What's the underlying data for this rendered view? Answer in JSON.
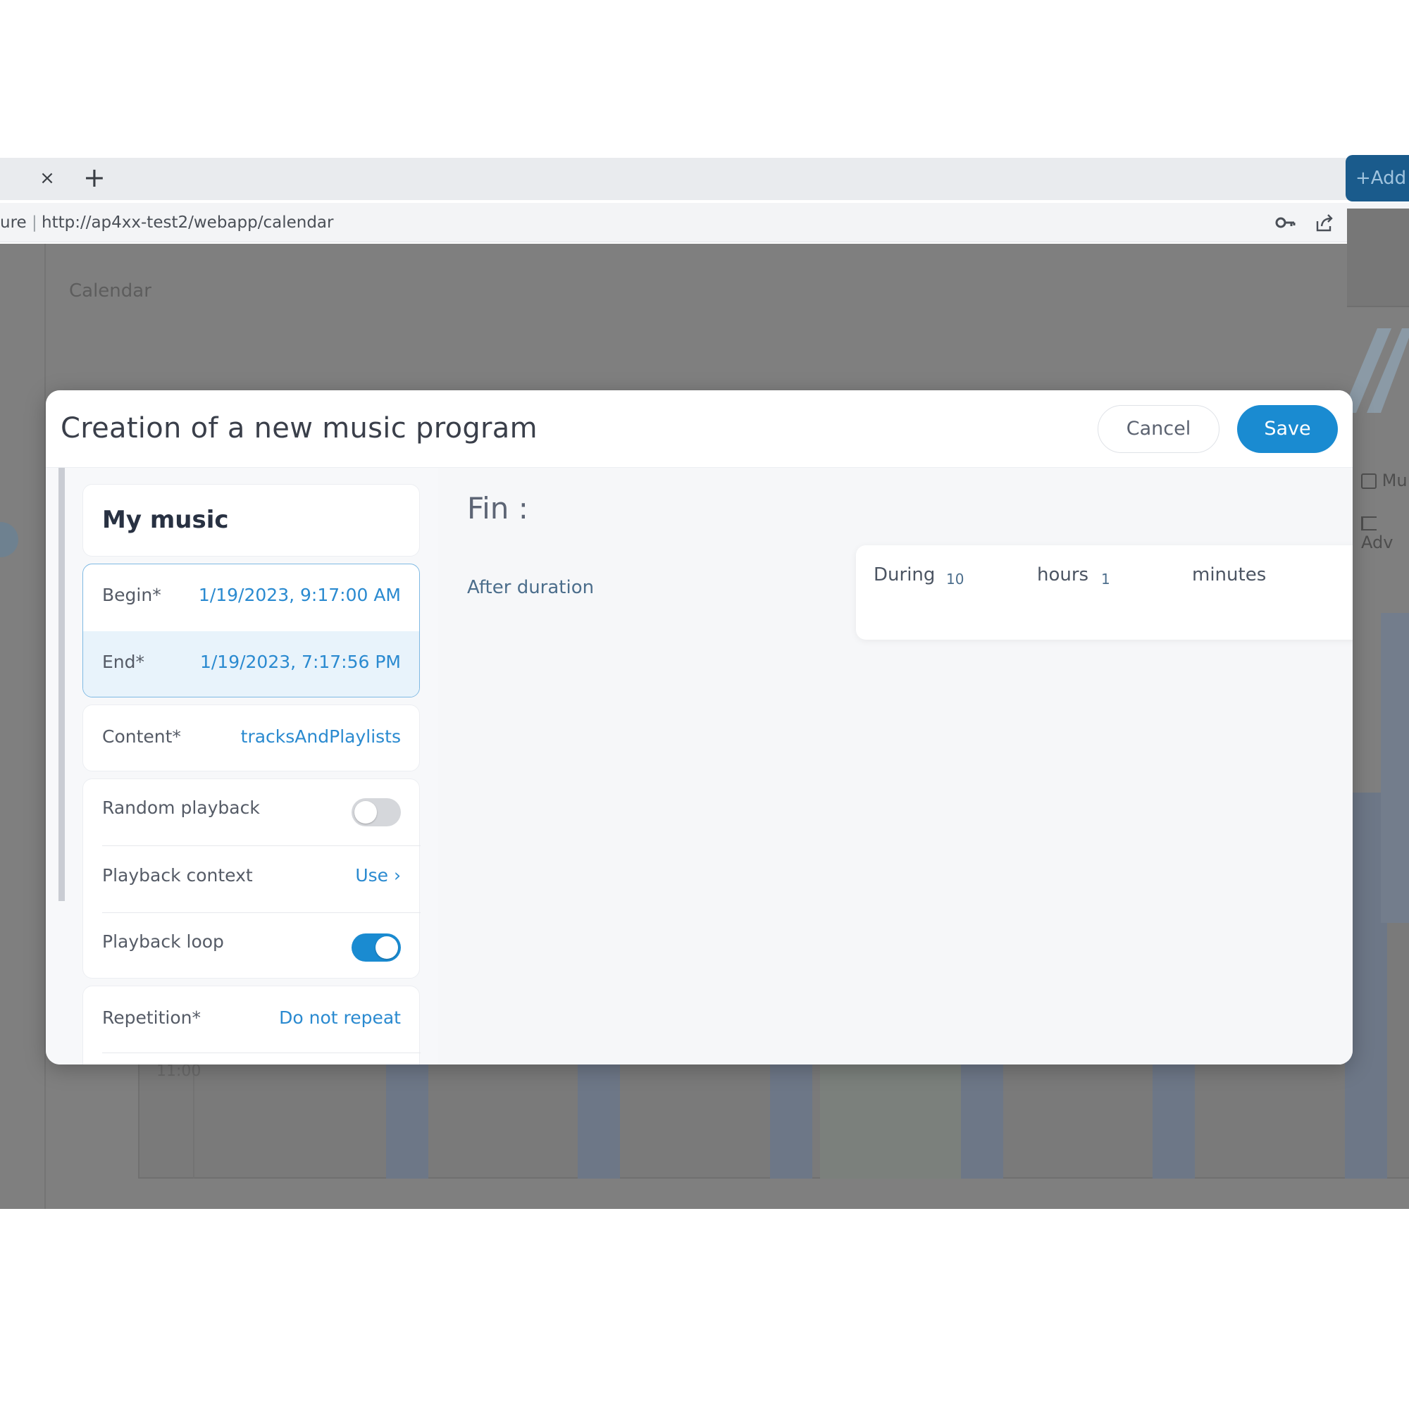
{
  "browser": {
    "tab_close": "×",
    "new_tab": "+",
    "url_prefix": "ure",
    "url": "http://ap4xx-test2/webapp/calendar",
    "icons": [
      "key-icon",
      "share-icon",
      "star-icon"
    ]
  },
  "app": {
    "title": "Calendar",
    "add_label": "+Add",
    "side_items": [
      {
        "icon": "music-note-icon",
        "label": "Mu"
      },
      {
        "icon": "megaphone-icon",
        "label": "Adv"
      }
    ],
    "time_label": "11:00"
  },
  "modal": {
    "title": "Creation of a new music program",
    "cancel_label": "Cancel",
    "save_label": "Save",
    "form": {
      "name": "My music",
      "begin_label": "Begin*",
      "begin_value": "1/19/2023, 9:17:00 AM",
      "end_label": "End*",
      "end_value": "1/19/2023, 7:17:56 PM",
      "content_label": "Content*",
      "content_value": "tracksAndPlaylists",
      "random_label": "Random playback",
      "random_on": false,
      "context_label": "Playback context",
      "context_value": "Use ›",
      "loop_label": "Playback loop",
      "loop_on": true,
      "repetition_label": "Repetition*",
      "repetition_value": "Do not repeat"
    },
    "end_section": {
      "heading": "Fin :",
      "mode_label": "After duration",
      "during_label": "During",
      "hours_value": "10",
      "hours_label": "hours",
      "minutes_value": "1",
      "minutes_label": "minutes"
    }
  },
  "colors": {
    "accent": "#1a8bd1",
    "link": "#2a8ad0",
    "toggle_off": "#d5d7db"
  }
}
